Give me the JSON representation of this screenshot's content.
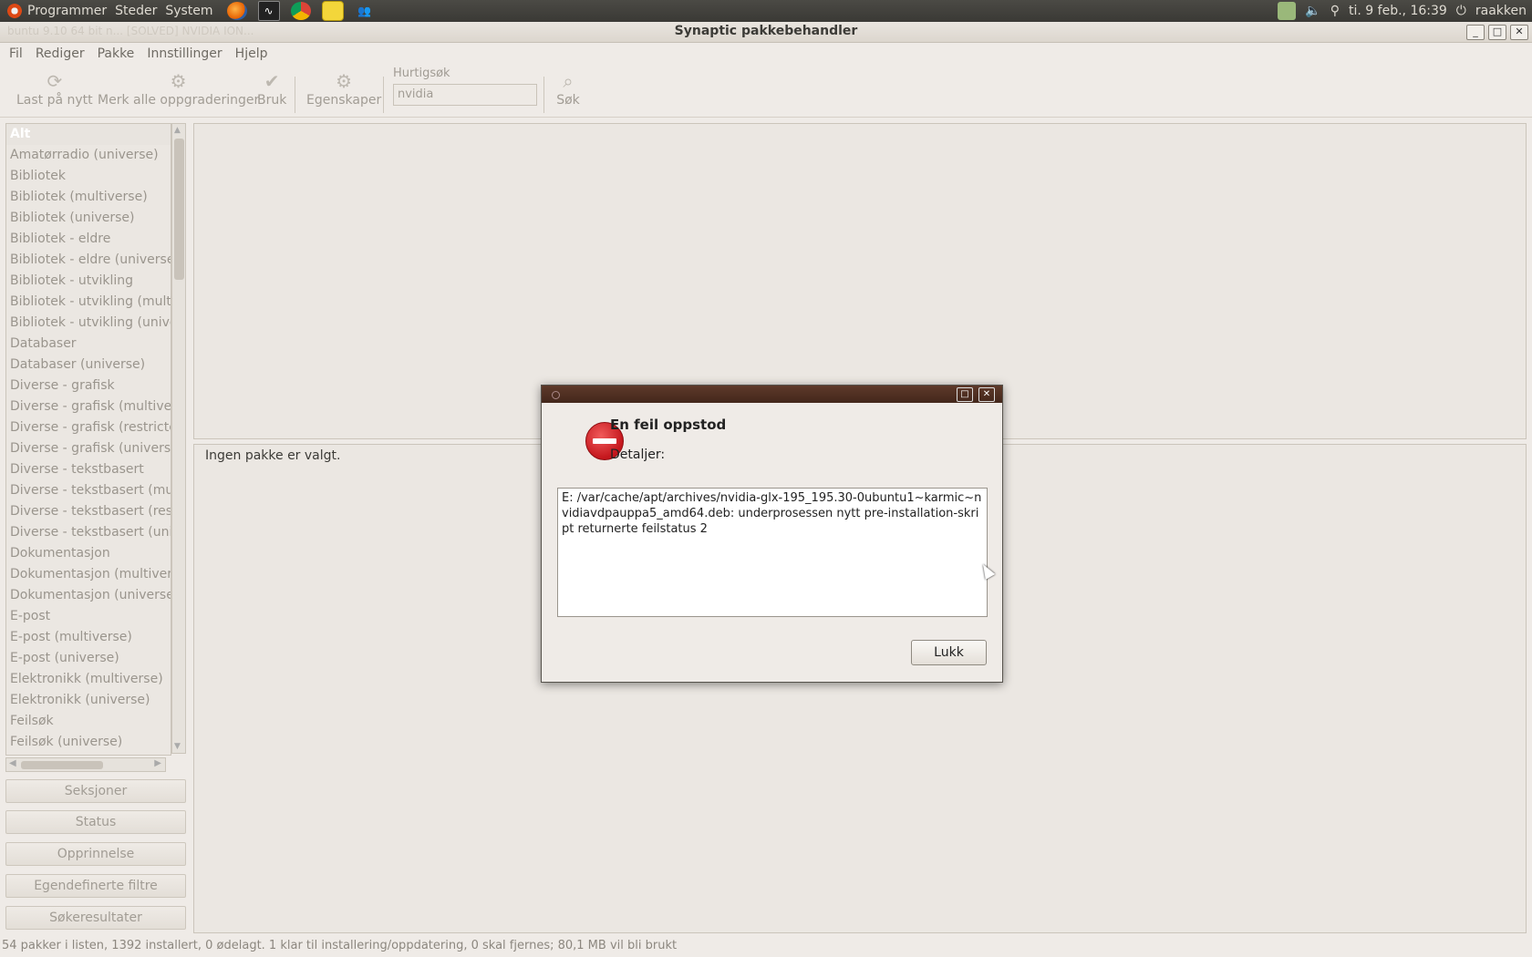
{
  "top_panel": {
    "menus": [
      "Programmer",
      "Steder",
      "System"
    ],
    "launchers": [
      "firefox-icon",
      "system-monitor-icon",
      "chrome-icon",
      "notes-icon",
      "users-icon"
    ],
    "datetime": "ti. 9 feb., 16:39",
    "user": "raakken"
  },
  "window": {
    "title": "Synaptic pakkebehandler",
    "background_tabs": "buntu 9.10 64 bit n...     [SOLVED] NVIDIA ION..."
  },
  "menubar": [
    "Fil",
    "Rediger",
    "Pakke",
    "Innstillinger",
    "Hjelp"
  ],
  "toolbar": {
    "reload": "Last på nytt",
    "mark_upgrades": "Merk alle oppgraderinger",
    "apply": "Bruk",
    "properties": "Egenskaper",
    "quick_search_label": "Hurtigsøk",
    "quick_search_value": "nvidia",
    "search": "Søk"
  },
  "sections": [
    "Alt",
    "Amatørradio (universe)",
    "Bibliotek",
    "Bibliotek (multiverse)",
    "Bibliotek (universe)",
    "Bibliotek - eldre",
    "Bibliotek - eldre (universe)",
    "Bibliotek - utvikling",
    "Bibliotek - utvikling (multi",
    "Bibliotek - utvikling (unive",
    "Databaser",
    "Databaser (universe)",
    "Diverse - grafisk",
    "Diverse - grafisk (multivers",
    "Diverse - grafisk (restricted",
    "Diverse - grafisk (universe",
    "Diverse - tekstbasert",
    "Diverse - tekstbasert (mult",
    "Diverse - tekstbasert (restr",
    "Diverse - tekstbasert (univ",
    "Dokumentasjon",
    "Dokumentasjon (multivers",
    "Dokumentasjon (universe)",
    "E-post",
    "E-post (multiverse)",
    "E-post (universe)",
    "Elektronikk (multiverse)",
    "Elektronikk (universe)",
    "Feilsøk",
    "Feilsøk (universe)"
  ],
  "filter_buttons": [
    "Seksjoner",
    "Status",
    "Opprinnelse",
    "Egendefinerte filtre",
    "Søkeresultater"
  ],
  "details": {
    "text": "Ingen pakke er valgt."
  },
  "statusbar": "54 pakker i listen, 1392 installert, 0 ødelagt. 1 klar til installering/oppdatering, 0 skal fjernes; 80,1 MB vil bli brukt",
  "dialog": {
    "title": "En feil oppstod",
    "subtitle": "Detaljer:",
    "detail": "E: /var/cache/apt/archives/nvidia-glx-195_195.30-0ubuntu1~karmic~nvidiavdpauppa5_amd64.deb: underprosessen nytt pre-installation-skript returnerte feilstatus 2",
    "close": "Lukk"
  }
}
